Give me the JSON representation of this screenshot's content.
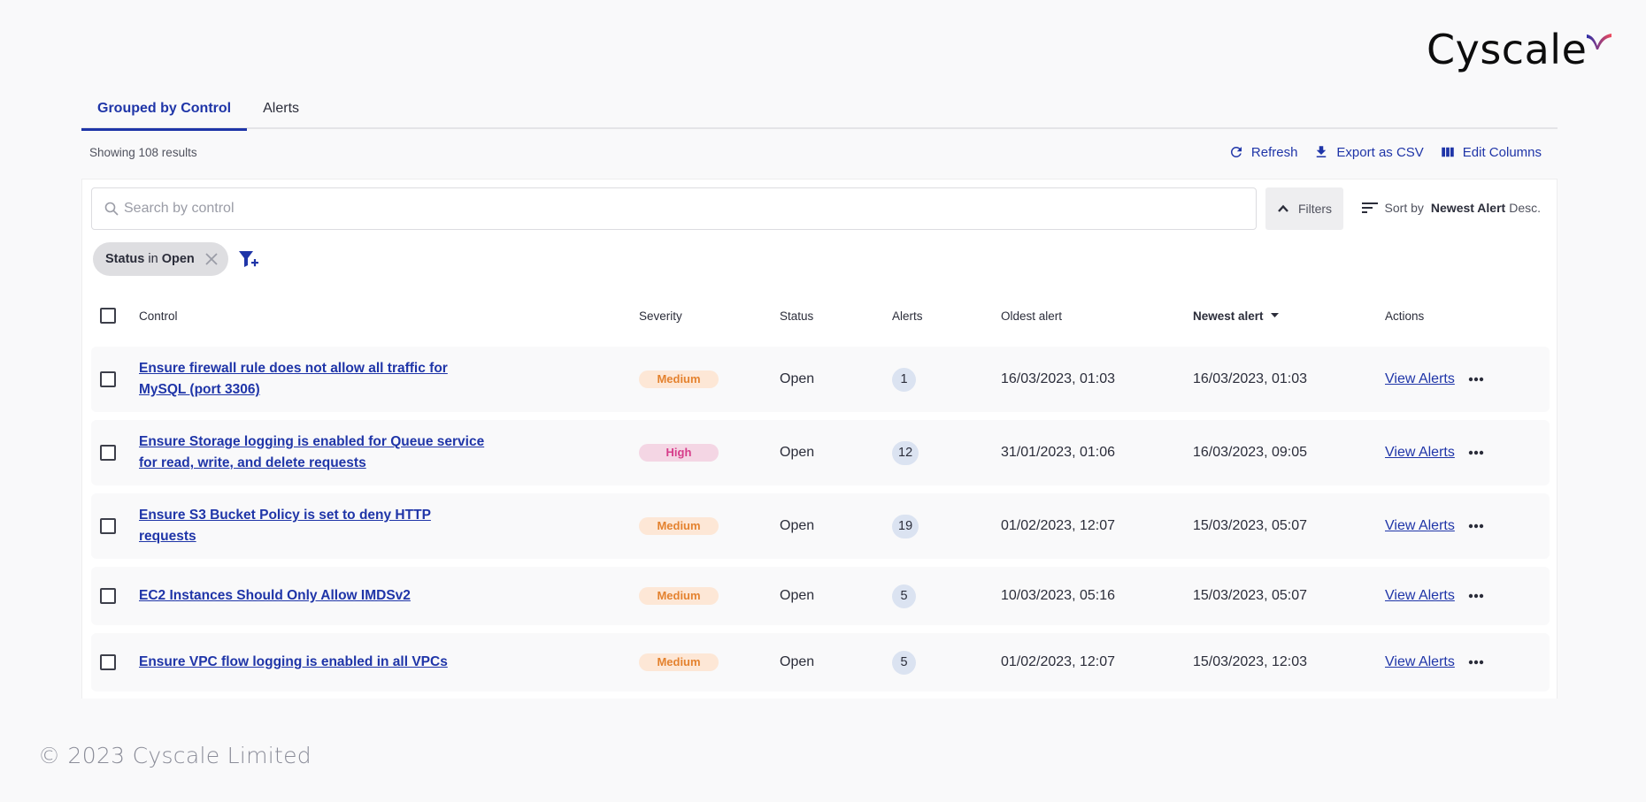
{
  "brand": {
    "name": "Cyscale",
    "accent_colors": [
      "#2b2fa8",
      "#f04a5c"
    ]
  },
  "tabs": [
    {
      "label": "Grouped by Control",
      "active": true
    },
    {
      "label": "Alerts",
      "active": false
    }
  ],
  "results": {
    "text": "Showing 108 results"
  },
  "toolbar": {
    "refresh_label": "Refresh",
    "export_label": "Export as CSV",
    "edit_columns_label": "Edit Columns"
  },
  "search": {
    "placeholder": "Search by control",
    "value": ""
  },
  "filters_button": {
    "label": "Filters"
  },
  "sort": {
    "prefix": "Sort by",
    "field": "Newest Alert",
    "direction": "Desc."
  },
  "active_filters": [
    {
      "field": "Status",
      "operator": "in",
      "value": "Open"
    }
  ],
  "table": {
    "columns": {
      "control": "Control",
      "severity": "Severity",
      "status": "Status",
      "alerts": "Alerts",
      "oldest": "Oldest alert",
      "newest": "Newest alert",
      "actions": "Actions"
    },
    "rows": [
      {
        "control": "Ensure firewall rule does not allow all traffic for MySQL (port 3306)",
        "severity": "Medium",
        "status": "Open",
        "alerts": "1",
        "oldest": "16/03/2023, 01:03",
        "newest": "16/03/2023, 01:03",
        "action": "View Alerts"
      },
      {
        "control": "Ensure Storage logging is enabled for Queue service for read, write, and delete requests",
        "severity": "High",
        "status": "Open",
        "alerts": "12",
        "oldest": "31/01/2023, 01:06",
        "newest": "16/03/2023, 09:05",
        "action": "View Alerts"
      },
      {
        "control": "Ensure S3 Bucket Policy is set to deny HTTP requests",
        "severity": "Medium",
        "status": "Open",
        "alerts": "19",
        "oldest": "01/02/2023, 12:07",
        "newest": "15/03/2023, 05:07",
        "action": "View Alerts"
      },
      {
        "control": "EC2 Instances Should Only Allow IMDSv2",
        "severity": "Medium",
        "status": "Open",
        "alerts": "5",
        "oldest": "10/03/2023, 05:16",
        "newest": "15/03/2023, 05:07",
        "action": "View Alerts"
      },
      {
        "control": "Ensure VPC flow logging is enabled in all VPCs",
        "severity": "Medium",
        "status": "Open",
        "alerts": "5",
        "oldest": "01/02/2023, 12:07",
        "newest": "15/03/2023, 12:03",
        "action": "View Alerts"
      }
    ]
  },
  "footer": {
    "text": "© 2023 Cyscale Limited"
  }
}
